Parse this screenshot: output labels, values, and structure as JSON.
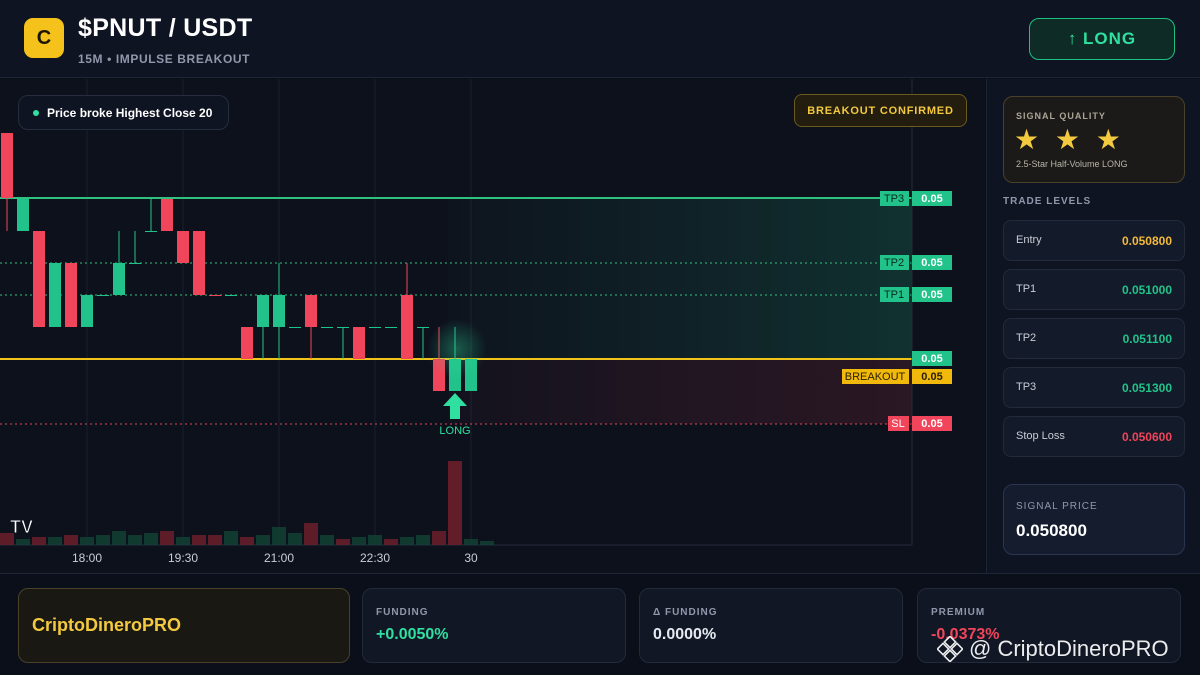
{
  "header": {
    "logo_letter": "C",
    "pair": "$PNUT / USDT",
    "subtitle": "15M • IMPULSE BREAKOUT",
    "signal_button": "↑ LONG"
  },
  "chart": {
    "note": "Price broke Highest Close 20",
    "confirmed_badge": "BREAKOUT CONFIRMED",
    "long_marker": "LONG",
    "tv_logo": "TV",
    "time_labels": [
      "18:00",
      "19:30",
      "21:00",
      "22:30",
      "30"
    ],
    "price_tags": [
      {
        "label": "TP3",
        "value": "0.05",
        "color": "#22c38a"
      },
      {
        "label": "TP2",
        "value": "0.05",
        "color": "#22c38a"
      },
      {
        "label": "TP1",
        "value": "0.05",
        "color": "#22c38a"
      },
      {
        "label": "",
        "value": "0.05",
        "color": "#22c38a"
      },
      {
        "label": "BREAKOUT",
        "value": "0.05",
        "color": "#f0b90b"
      },
      {
        "label": "SL",
        "value": "0.05",
        "color": "#f0455a"
      }
    ]
  },
  "sidebar": {
    "quality_title": "SIGNAL QUALITY",
    "stars": "★ ★ ★",
    "quality_desc": "2.5-Star Half-Volume LONG",
    "levels_title": "TRADE LEVELS",
    "levels": [
      {
        "name": "Entry",
        "value": "0.050800",
        "color": "#f3b93a"
      },
      {
        "name": "TP1",
        "value": "0.051000",
        "color": "#22c38a"
      },
      {
        "name": "TP2",
        "value": "0.051100",
        "color": "#22c38a"
      },
      {
        "name": "TP3",
        "value": "0.051300",
        "color": "#22c38a"
      },
      {
        "name": "Stop Loss",
        "value": "0.050600",
        "color": "#f0455a"
      }
    ],
    "signal_price_label": "SIGNAL PRICE",
    "signal_price": "0.050800"
  },
  "footer": {
    "brand": "CriptoDineroPRO",
    "cards": [
      {
        "name": "FUNDING",
        "value": "+0.0050%",
        "color": "#2fe0a0"
      },
      {
        "name": "Δ FUNDING",
        "value": "0.0000%",
        "color": "#e6e9ef"
      },
      {
        "name": "PREMIUM",
        "value": "-0.0373%",
        "color": "#f0455a"
      }
    ],
    "watermark": "@ CriptoDineroPRO"
  }
}
